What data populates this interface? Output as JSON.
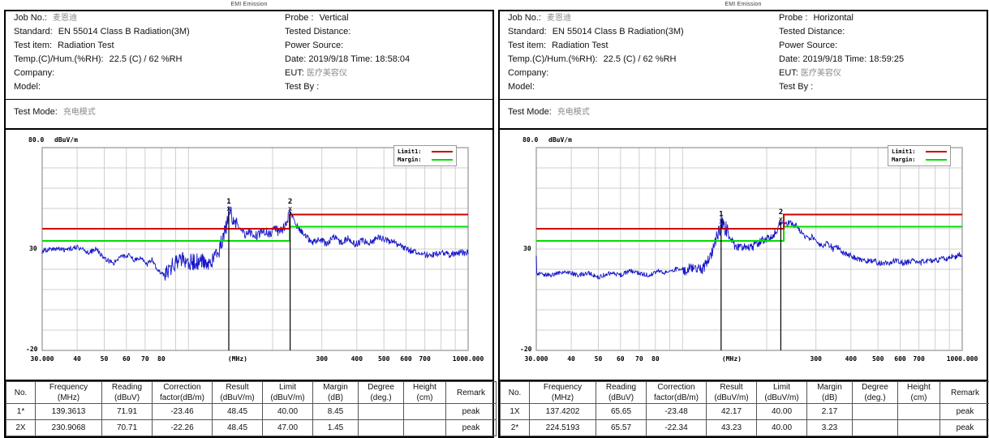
{
  "panels": [
    {
      "top_caption": "EMI Emission",
      "info": {
        "left": [
          {
            "label": "Job No.:",
            "value": "麦恩迪",
            "chinese": true
          },
          {
            "label": "Standard:",
            "value": "EN 55014 Class B Radiation(3M)",
            "chinese": false
          },
          {
            "label": "Test item:",
            "value": "Radiation Test",
            "chinese": false
          },
          {
            "label": "Temp.(C)/Hum.(%RH):",
            "value": "22.5 (C) / 62 %RH",
            "chinese": false
          },
          {
            "label": "Company:",
            "value": "",
            "chinese": false
          },
          {
            "label": "Model:",
            "value": "",
            "chinese": false
          }
        ],
        "right": [
          {
            "label": "Probe :",
            "value": "Vertical",
            "chinese": false
          },
          {
            "label": "Tested Distance:",
            "value": "",
            "chinese": false
          },
          {
            "label": "Power Source:",
            "value": "",
            "chinese": false
          },
          {
            "label": "Date: 2019/9/18   Time: 18:58:04",
            "value": "",
            "chinese": false
          },
          {
            "label": "EUT:",
            "value": "医疗美容仪",
            "chinese": true
          },
          {
            "label": "Test By :",
            "value": "",
            "chinese": false
          }
        ],
        "test_mode_label": "Test Mode:",
        "test_mode_value": "充电模式"
      },
      "chart_data": {
        "type": "line",
        "title": "",
        "xlabel": "(MHz)",
        "ylabel": "dBuV/m",
        "ylim": [
          -20,
          80
        ],
        "ytick_labels": [
          "80.0",
          "30",
          "-20"
        ],
        "xtick_labels": [
          "30.000",
          "40",
          "50",
          "60",
          "70",
          "80",
          "300",
          "400",
          "500",
          "600",
          "700",
          "1000.000"
        ],
        "xlim": [
          30,
          1000
        ],
        "xscale": "log",
        "grid": true,
        "legend_position": "top-right",
        "legend": [
          {
            "name": "Limit1:",
            "color": "#cc0000"
          },
          {
            "name": "Margin:",
            "color": "#00dd00"
          }
        ],
        "series": [
          {
            "name": "trace",
            "color": "#1616c8"
          },
          {
            "name": "Limit1",
            "color": "#cc0000",
            "segments": [
              {
                "x": [
                  30,
                  230
                ],
                "y": 40.0
              },
              {
                "x": [
                  230,
                  1000
                ],
                "y": 47.0
              }
            ]
          },
          {
            "name": "Margin",
            "color": "#00dd00",
            "segments": [
              {
                "x": [
                  30,
                  230
                ],
                "y": 34.0
              },
              {
                "x": [
                  230,
                  1000
                ],
                "y": 41.0
              }
            ]
          }
        ],
        "markers": [
          {
            "label": "1",
            "freq_mhz": 139.3613,
            "value_dbuvm": 48.45
          },
          {
            "label": "2",
            "freq_mhz": 230.9068,
            "value_dbuvm": 48.45
          }
        ]
      },
      "table": {
        "headers": [
          {
            "l1": "No.",
            "l2": ""
          },
          {
            "l1": "Frequency",
            "l2": "(MHz)"
          },
          {
            "l1": "Reading",
            "l2": "(dBuV)"
          },
          {
            "l1": "Correction",
            "l2": "factor(dB/m)"
          },
          {
            "l1": "Result",
            "l2": "(dBuV/m)"
          },
          {
            "l1": "Limit",
            "l2": "(dBuV/m)"
          },
          {
            "l1": "Margin",
            "l2": "(dB)"
          },
          {
            "l1": "Degree",
            "l2": "(deg.)"
          },
          {
            "l1": "Height",
            "l2": "(cm)"
          },
          {
            "l1": "Remark",
            "l2": ""
          }
        ],
        "rows": [
          [
            "1*",
            "139.3613",
            "71.91",
            "-23.46",
            "48.45",
            "40.00",
            "8.45",
            "",
            "",
            "peak"
          ],
          [
            "2X",
            "230.9068",
            "70.71",
            "-22.26",
            "48.45",
            "47.00",
            "1.45",
            "",
            "",
            "peak"
          ]
        ]
      }
    },
    {
      "top_caption": "EMI Emission",
      "info": {
        "left": [
          {
            "label": "Job No.:",
            "value": "麦恩迪",
            "chinese": true
          },
          {
            "label": "Standard:",
            "value": "EN 55014 Class B Radiation(3M)",
            "chinese": false
          },
          {
            "label": "Test item:",
            "value": "Radiation Test",
            "chinese": false
          },
          {
            "label": "Temp.(C)/Hum.(%RH):",
            "value": "22.5 (C) / 62 %RH",
            "chinese": false
          },
          {
            "label": "Company:",
            "value": "",
            "chinese": false
          },
          {
            "label": "Model:",
            "value": "",
            "chinese": false
          }
        ],
        "right": [
          {
            "label": "Probe :",
            "value": "Horizontal",
            "chinese": false
          },
          {
            "label": "Tested Distance:",
            "value": "",
            "chinese": false
          },
          {
            "label": "Power Source:",
            "value": "",
            "chinese": false
          },
          {
            "label": "Date: 2019/9/18   Time: 18:59:25",
            "value": "",
            "chinese": false
          },
          {
            "label": "EUT:",
            "value": "医疗美容仪",
            "chinese": true
          },
          {
            "label": "Test By :",
            "value": "",
            "chinese": false
          }
        ],
        "test_mode_label": "Test Mode:",
        "test_mode_value": "充电模式"
      },
      "chart_data": {
        "type": "line",
        "title": "",
        "xlabel": "(MHz)",
        "ylabel": "dBuV/m",
        "ylim": [
          -20,
          80
        ],
        "ytick_labels": [
          "80.0",
          "30",
          "-20"
        ],
        "xtick_labels": [
          "30.000",
          "40",
          "50",
          "60",
          "70",
          "80",
          "300",
          "400",
          "500",
          "600",
          "700",
          "1000.000"
        ],
        "xlim": [
          30,
          1000
        ],
        "xscale": "log",
        "grid": true,
        "legend_position": "top-right",
        "legend": [
          {
            "name": "Limit1:",
            "color": "#cc0000"
          },
          {
            "name": "Margin:",
            "color": "#00dd00"
          }
        ],
        "series": [
          {
            "name": "trace",
            "color": "#1616c8"
          },
          {
            "name": "Limit1",
            "color": "#cc0000",
            "segments": [
              {
                "x": [
                  30,
                  230
                ],
                "y": 40.0
              },
              {
                "x": [
                  230,
                  1000
                ],
                "y": 47.0
              }
            ]
          },
          {
            "name": "Margin",
            "color": "#00dd00",
            "segments": [
              {
                "x": [
                  30,
                  230
                ],
                "y": 34.0
              },
              {
                "x": [
                  230,
                  1000
                ],
                "y": 41.0
              }
            ]
          }
        ],
        "markers": [
          {
            "label": "1",
            "freq_mhz": 137.4202,
            "value_dbuvm": 42.17
          },
          {
            "label": "2",
            "freq_mhz": 224.5193,
            "value_dbuvm": 43.23
          }
        ]
      },
      "table": {
        "headers": [
          {
            "l1": "No.",
            "l2": ""
          },
          {
            "l1": "Frequency",
            "l2": "(MHz)"
          },
          {
            "l1": "Reading",
            "l2": "(dBuV)"
          },
          {
            "l1": "Correction",
            "l2": "factor(dB/m)"
          },
          {
            "l1": "Result",
            "l2": "(dBuV/m)"
          },
          {
            "l1": "Limit",
            "l2": "(dBuV/m)"
          },
          {
            "l1": "Margin",
            "l2": "(dB)"
          },
          {
            "l1": "Degree",
            "l2": "(deg.)"
          },
          {
            "l1": "Height",
            "l2": "(cm)"
          },
          {
            "l1": "Remark",
            "l2": ""
          }
        ],
        "rows": [
          [
            "1X",
            "137.4202",
            "65.65",
            "-23.48",
            "42.17",
            "40.00",
            "2.17",
            "",
            "",
            "peak"
          ],
          [
            "2*",
            "224.5193",
            "65.57",
            "-22.34",
            "43.23",
            "40.00",
            "3.23",
            "",
            "",
            "peak"
          ]
        ]
      }
    }
  ]
}
